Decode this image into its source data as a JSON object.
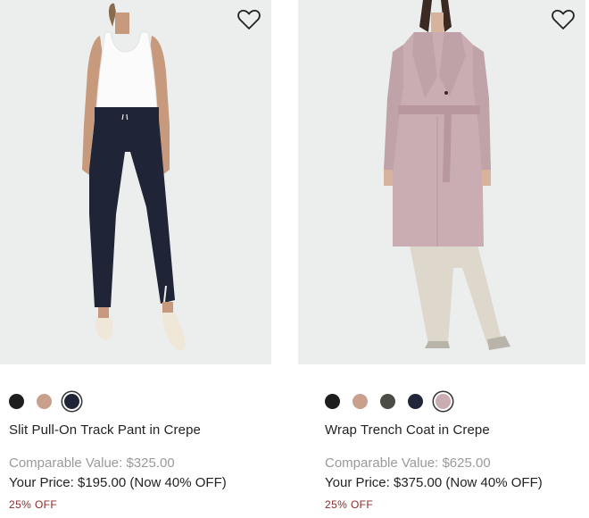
{
  "products": [
    {
      "title": "Slit Pull-On Track Pant in Crepe",
      "comparable": "Comparable Value: $325.00",
      "your_price": "Your Price: $195.00 (Now 40% OFF)",
      "discount": "25% OFF",
      "swatches": [
        {
          "color": "#1e1e1e",
          "selected": false
        },
        {
          "color": "#c9a08c",
          "selected": false
        },
        {
          "color": "#1f2436",
          "selected": true
        }
      ],
      "wishlist_icon": "heart-outline-icon"
    },
    {
      "title": "Wrap Trench Coat in Crepe",
      "comparable": "Comparable Value: $625.00",
      "your_price": "Your Price: $375.00 (Now 40% OFF)",
      "discount": "25% OFF",
      "swatches": [
        {
          "color": "#1e1e1e",
          "selected": false
        },
        {
          "color": "#c9a08c",
          "selected": false
        },
        {
          "color": "#4b4c45",
          "selected": false
        },
        {
          "color": "#22263a",
          "selected": false
        },
        {
          "color": "#c9adb3",
          "selected": true
        }
      ],
      "wishlist_icon": "heart-outline-icon"
    }
  ]
}
